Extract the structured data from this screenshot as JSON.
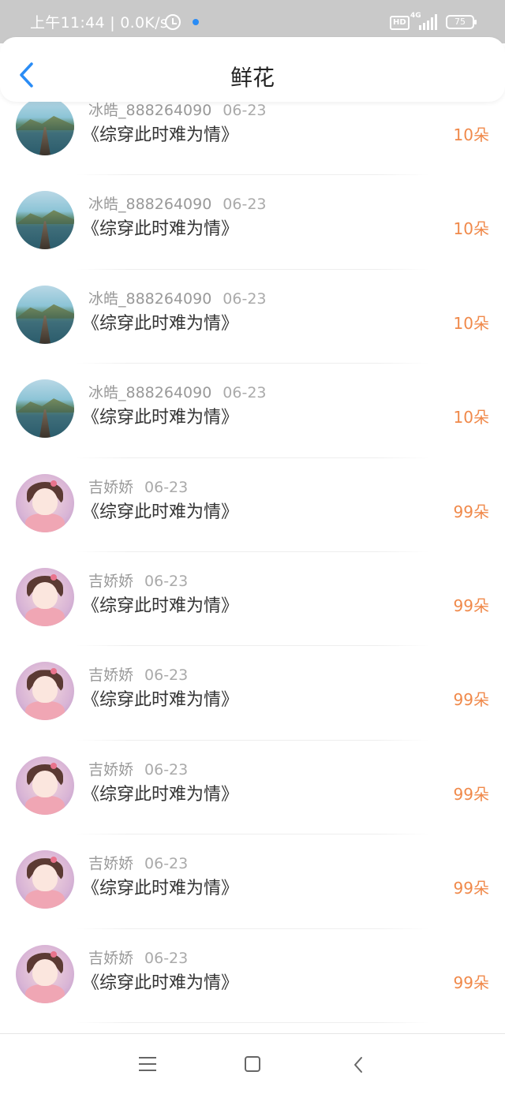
{
  "status_bar": {
    "time": "上午11:44 | 0.0K/s",
    "hd": "HD",
    "network": "4G",
    "battery": "75"
  },
  "header": {
    "title": "鲜花"
  },
  "items": [
    {
      "user": "冰皓_888264090",
      "date": "06-23",
      "book": "《综穿此时难为情》",
      "count": "10朵",
      "avatar": "lake"
    },
    {
      "user": "冰皓_888264090",
      "date": "06-23",
      "book": "《综穿此时难为情》",
      "count": "10朵",
      "avatar": "lake"
    },
    {
      "user": "冰皓_888264090",
      "date": "06-23",
      "book": "《综穿此时难为情》",
      "count": "10朵",
      "avatar": "lake"
    },
    {
      "user": "冰皓_888264090",
      "date": "06-23",
      "book": "《综穿此时难为情》",
      "count": "10朵",
      "avatar": "lake"
    },
    {
      "user": "吉娇娇",
      "date": "06-23",
      "book": "《综穿此时难为情》",
      "count": "99朵",
      "avatar": "girl"
    },
    {
      "user": "吉娇娇",
      "date": "06-23",
      "book": "《综穿此时难为情》",
      "count": "99朵",
      "avatar": "girl"
    },
    {
      "user": "吉娇娇",
      "date": "06-23",
      "book": "《综穿此时难为情》",
      "count": "99朵",
      "avatar": "girl"
    },
    {
      "user": "吉娇娇",
      "date": "06-23",
      "book": "《综穿此时难为情》",
      "count": "99朵",
      "avatar": "girl"
    },
    {
      "user": "吉娇娇",
      "date": "06-23",
      "book": "《综穿此时难为情》",
      "count": "99朵",
      "avatar": "girl"
    },
    {
      "user": "吉娇娇",
      "date": "06-23",
      "book": "《综穿此时难为情》",
      "count": "99朵",
      "avatar": "girl"
    }
  ],
  "icons": {
    "back": "chevron-left-icon",
    "nav_menu": "menu-icon",
    "nav_home": "home-square-icon",
    "nav_back": "back-chevron-icon"
  },
  "colors": {
    "accent": "#2a8cf5",
    "count": "#f0894a"
  }
}
